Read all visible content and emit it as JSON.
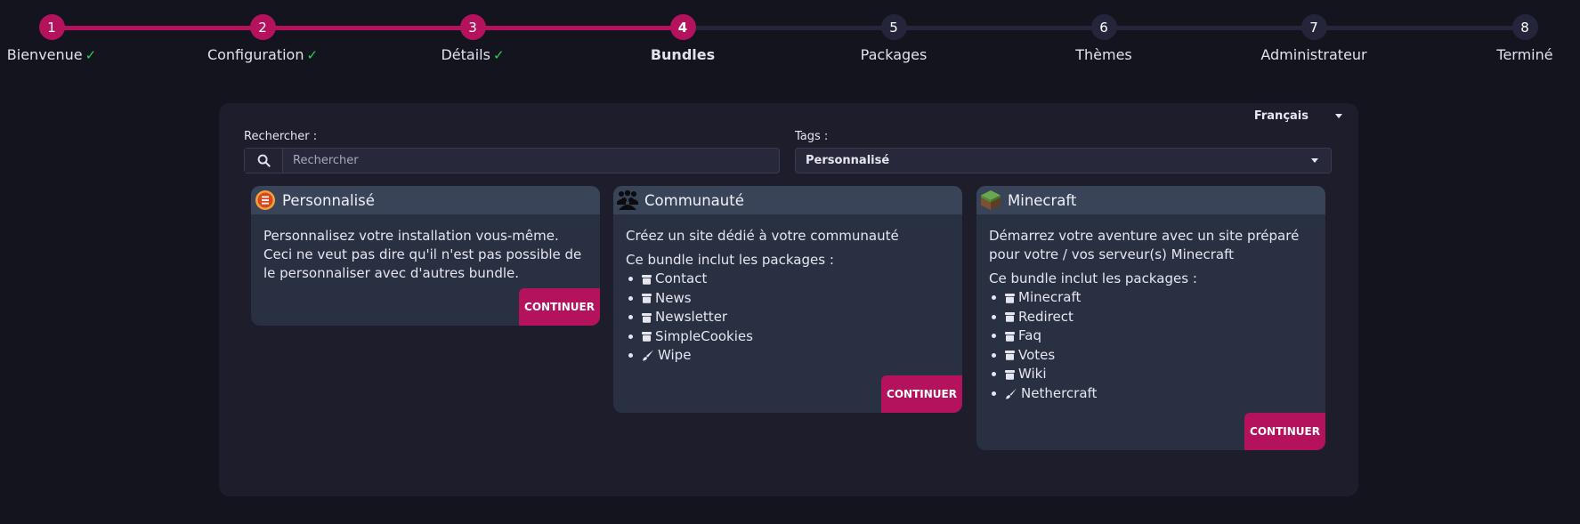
{
  "stepper": {
    "steps": [
      {
        "number": "1",
        "label": "Bienvenue",
        "status": "done"
      },
      {
        "number": "2",
        "label": "Configuration",
        "status": "done"
      },
      {
        "number": "3",
        "label": "Détails",
        "status": "done"
      },
      {
        "number": "4",
        "label": "Bundles",
        "status": "current"
      },
      {
        "number": "5",
        "label": "Packages",
        "status": "todo"
      },
      {
        "number": "6",
        "label": "Thèmes",
        "status": "todo"
      },
      {
        "number": "7",
        "label": "Administrateur",
        "status": "todo"
      },
      {
        "number": "8",
        "label": "Terminé",
        "status": "todo"
      }
    ],
    "check_glyph": "✓"
  },
  "colors": {
    "accent": "#b5125e",
    "check": "#2fcf55",
    "background": "#14141f",
    "panel": "#1e1d2c",
    "card": "#283042",
    "card_header": "#3a4458"
  },
  "language": {
    "selected": "Français"
  },
  "search": {
    "label": "Rechercher :",
    "placeholder": "Rechercher",
    "value": "",
    "icon": "search-icon"
  },
  "tags": {
    "label": "Tags :",
    "selected": "Personnalisé"
  },
  "cards": [
    {
      "title": "Personnalisé",
      "icon": "custom-bundle-icon",
      "description": [
        "Personnalisez votre installation vous-même.",
        "Ceci ne veut pas dire qu'il n'est pas possible de le personnaliser avec d'autres bundle."
      ],
      "button": "CONTINUER"
    },
    {
      "title": "Communauté",
      "icon": "users-icon",
      "description": [
        "Créez un site dédié à votre communauté"
      ],
      "packages_intro": "Ce bundle inclut les packages :",
      "packages": [
        {
          "name": "Contact",
          "icon": "package-icon"
        },
        {
          "name": "News",
          "icon": "package-icon"
        },
        {
          "name": "Newsletter",
          "icon": "package-icon"
        },
        {
          "name": "SimpleCookies",
          "icon": "package-icon"
        },
        {
          "name": "Wipe",
          "icon": "brush-icon"
        }
      ],
      "button": "CONTINUER"
    },
    {
      "title": "Minecraft",
      "icon": "minecraft-grass-block-icon",
      "description": [
        "Démarrez votre aventure avec un site préparé pour votre / vos serveur(s) Minecraft"
      ],
      "packages_intro": "Ce bundle inclut les packages :",
      "packages": [
        {
          "name": "Minecraft",
          "icon": "package-icon"
        },
        {
          "name": "Redirect",
          "icon": "package-icon"
        },
        {
          "name": "Faq",
          "icon": "package-icon"
        },
        {
          "name": "Votes",
          "icon": "package-icon"
        },
        {
          "name": "Wiki",
          "icon": "package-icon"
        },
        {
          "name": "Nethercraft",
          "icon": "brush-icon"
        }
      ],
      "button": "CONTINUER"
    }
  ]
}
